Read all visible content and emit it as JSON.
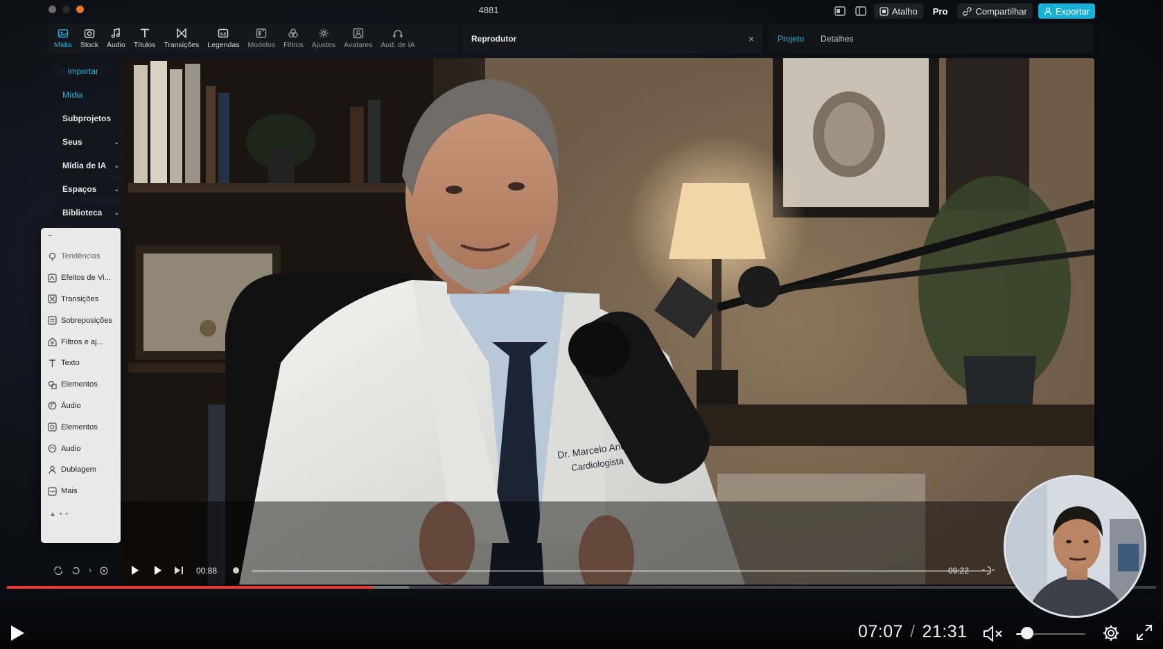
{
  "window": {
    "title": "4881",
    "dot_colors": [
      "#6b6b6b",
      "#2a2a2a",
      "#e8742b"
    ]
  },
  "topbar": {
    "shortcut_label": "Atalho",
    "pro_label": "Pro",
    "share_label": "Compartilhar",
    "export_label": "Exportar",
    "accent": "#17b0d8"
  },
  "toolbar": {
    "items": [
      {
        "label": "Mídia",
        "icon": "media-icon"
      },
      {
        "label": "Stock",
        "icon": "stock-icon"
      },
      {
        "label": "Áudio",
        "icon": "audio-icon"
      },
      {
        "label": "Títulos",
        "icon": "title-icon"
      },
      {
        "label": "Transições",
        "icon": "transition-icon"
      },
      {
        "label": "Legendas",
        "icon": "captions-icon"
      },
      {
        "label": "Modelos",
        "icon": "templates-icon"
      },
      {
        "label": "Filtros",
        "icon": "filters-icon"
      },
      {
        "label": "Ajustes",
        "icon": "adjust-icon"
      },
      {
        "label": "Avatares",
        "icon": "avatar-icon"
      },
      {
        "label": "Aud. de IA",
        "icon": "ai-audio-icon"
      }
    ]
  },
  "player_tab": {
    "title": "Reprodutor",
    "close_glyph": "×"
  },
  "right_tabs": {
    "project": "Projeto",
    "details": "Detalhes"
  },
  "left_nav": {
    "items": [
      {
        "label": "· Importar",
        "chevron": false
      },
      {
        "label": "Mídia",
        "chevron": false
      },
      {
        "label": "Subprojetos",
        "chevron": false
      },
      {
        "label": "Seus",
        "chevron": true
      },
      {
        "label": "Mídia de IA",
        "chevron": true
      },
      {
        "label": "Espaços",
        "chevron": true
      },
      {
        "label": "Biblioteca",
        "chevron": true
      }
    ]
  },
  "effects_menu": {
    "items": [
      {
        "label": "Tendências",
        "icon": "trend-icon"
      },
      {
        "label": "Efeitos de Vi...",
        "icon": "video-effects-icon"
      },
      {
        "label": "Transições",
        "icon": "transition-icon"
      },
      {
        "label": "Sobreposições",
        "icon": "overlay-icon"
      },
      {
        "label": "Filtros e aj...",
        "icon": "filters-icon"
      },
      {
        "label": "Texto",
        "icon": "text-icon"
      },
      {
        "label": "Elementos",
        "icon": "elements-icon"
      },
      {
        "label": "Áudio",
        "icon": "audio-icon"
      },
      {
        "label": "Elementos",
        "icon": "elements-icon"
      },
      {
        "label": "Audio",
        "icon": "audio-icon"
      },
      {
        "label": "Dublagem",
        "icon": "dubbing-icon"
      },
      {
        "label": "Mais",
        "icon": "more-icon"
      }
    ]
  },
  "video": {
    "name_tag_line1": "Dr. Marcelo Andrade",
    "name_tag_line2": "Cardiologista"
  },
  "inner_player": {
    "current_time": "00:88",
    "duration": "09:22"
  },
  "playback": {
    "current_time": "07:07",
    "separator": "/",
    "duration": "21:31",
    "progress_fraction": 0.318,
    "buffered_fraction": 0.35,
    "volume_fraction": 0.12,
    "progress_color": "#e53a2e"
  }
}
